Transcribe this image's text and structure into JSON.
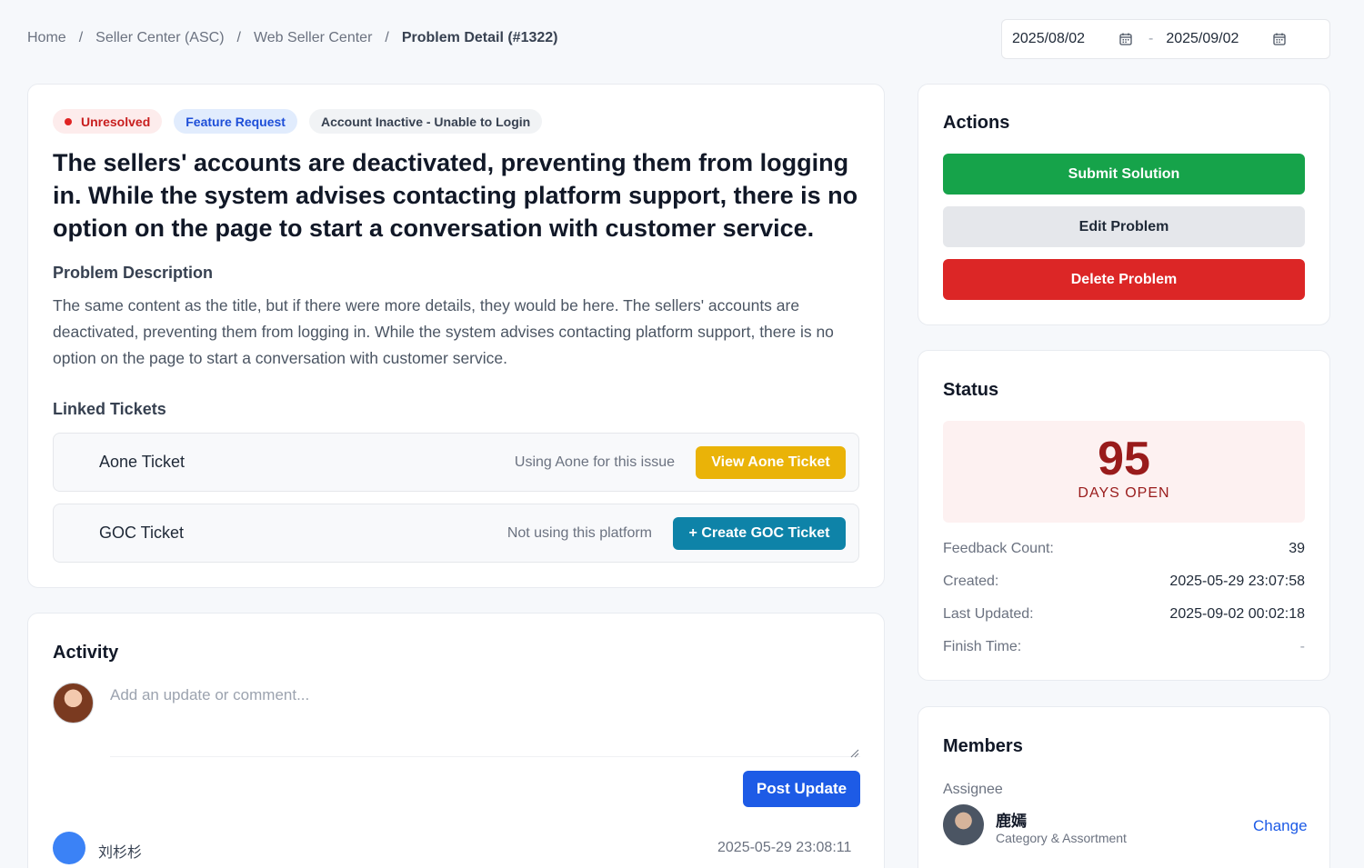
{
  "breadcrumb": {
    "items": [
      "Home",
      "Seller Center (ASC)",
      "Web Seller Center"
    ],
    "current": "Problem Detail (#1322)",
    "separator": "/"
  },
  "date_range": {
    "start": "2025/08/02",
    "end": "2025/09/02",
    "separator": "-"
  },
  "problem": {
    "tags": {
      "status": "Unresolved",
      "type": "Feature Request",
      "category": "Account Inactive - Unable to Login"
    },
    "title": "The sellers' accounts are deactivated, preventing them from logging in. While the system advises contacting platform support, there is no option on the page to start a conversation with customer service.",
    "description_heading": "Problem Description",
    "description": "The same content as the title, but if there were more details, they would be here. The sellers' accounts are deactivated, preventing them from logging in. While the system advises contacting platform support, there is no option on the page to start a conversation with customer service.",
    "linked_heading": "Linked Tickets",
    "tickets": [
      {
        "name": "Aone Ticket",
        "note": "Using Aone for this issue",
        "button": "View Aone Ticket"
      },
      {
        "name": "GOC Ticket",
        "note": "Not using this platform",
        "button": "+ Create GOC Ticket"
      }
    ]
  },
  "activity": {
    "heading": "Activity",
    "comment_placeholder": "Add an update or comment...",
    "post_button": "Post Update",
    "entries": [
      {
        "author": "刘杉杉",
        "time": "2025-05-29 23:08:11"
      }
    ]
  },
  "actions": {
    "heading": "Actions",
    "submit": "Submit Solution",
    "edit": "Edit Problem",
    "delete": "Delete Problem"
  },
  "status": {
    "heading": "Status",
    "days_open": "95",
    "days_open_label": "DAYS OPEN",
    "rows": [
      {
        "label": "Feedback Count:",
        "value": "39"
      },
      {
        "label": "Created:",
        "value": "2025-05-29 23:07:58"
      },
      {
        "label": "Last Updated:",
        "value": "2025-09-02 00:02:18"
      },
      {
        "label": "Finish Time:",
        "value": "-"
      }
    ]
  },
  "members": {
    "heading": "Members",
    "assignee_label": "Assignee",
    "assignee_name": "鹿嫣",
    "assignee_dept": "Category & Assortment",
    "change": "Change"
  },
  "colors": {
    "accent_blue": "#1d5be6",
    "success_green": "#16a34a",
    "danger_red": "#dc2626",
    "warning_yellow": "#eab308",
    "teal": "#0e83a8"
  }
}
